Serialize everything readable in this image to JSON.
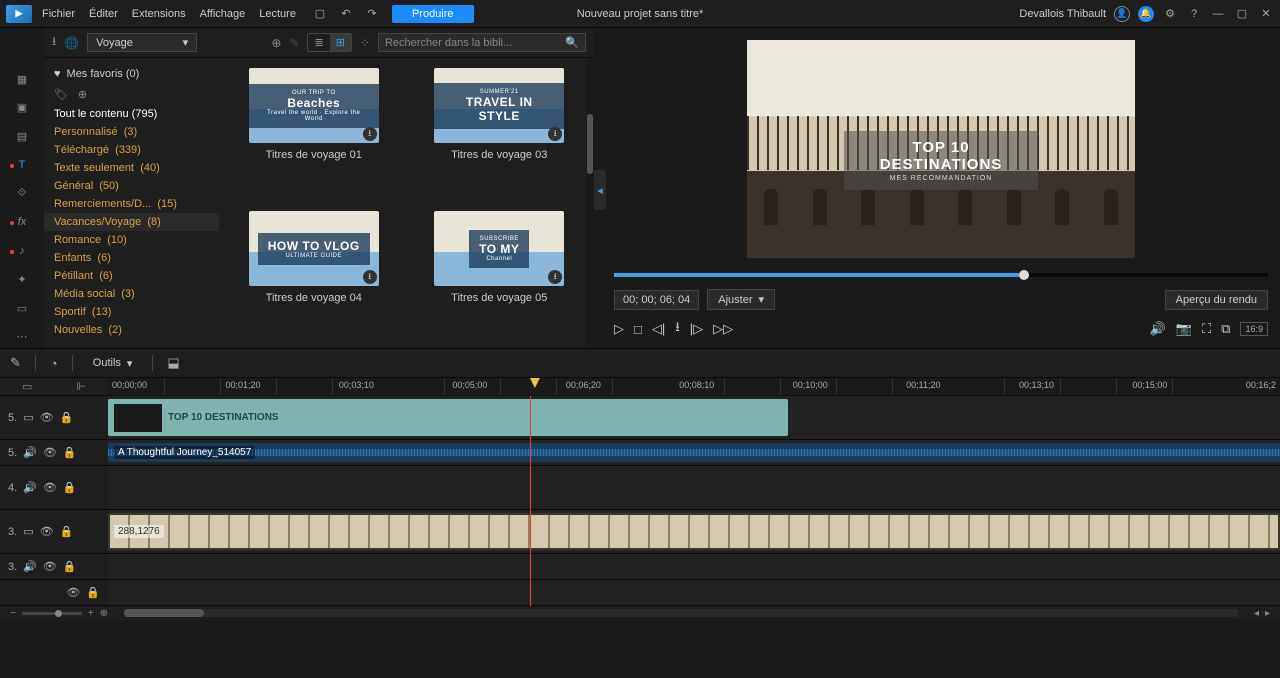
{
  "menu": {
    "file": "Fichier",
    "edit": "Éditer",
    "extensions": "Extensions",
    "display": "Affichage",
    "playback": "Lecture"
  },
  "topbar": {
    "produce": "Produire",
    "project_title": "Nouveau projet sans titre*",
    "username": "Devallois Thibault"
  },
  "room": {
    "category_selected": "Voyage",
    "search_placeholder": "Rechercher dans la bibli...",
    "favorites_label": "Mes favoris (0)",
    "all_content_label": "Tout le contenu (795)",
    "categories": [
      {
        "label": "Personnalisé",
        "count": "(3)"
      },
      {
        "label": "Téléchargé",
        "count": "(339)"
      },
      {
        "label": "Texte seulement",
        "count": "(40)"
      },
      {
        "label": "Général",
        "count": "(50)"
      },
      {
        "label": "Remerciements/D...",
        "count": "(15)"
      },
      {
        "label": "Vacances/Voyage",
        "count": "(8)"
      },
      {
        "label": "Romance",
        "count": "(10)"
      },
      {
        "label": "Enfants",
        "count": "(6)"
      },
      {
        "label": "Pétillant",
        "count": "(6)"
      },
      {
        "label": "Média social",
        "count": "(3)"
      },
      {
        "label": "Sportif",
        "count": "(13)"
      },
      {
        "label": "Nouvelles",
        "count": "(2)"
      }
    ],
    "templates": [
      {
        "name": "Titres de voyage 01",
        "ov_line1": "OUR TRIP TO",
        "ov_line2": "Beaches",
        "ov_line3": "Travel the world · Explore the World"
      },
      {
        "name": "Titres de voyage 03",
        "ov_line1": "SUMMER'21",
        "ov_line2": "TRAVEL IN STYLE",
        "ov_line3": ""
      },
      {
        "name": "Titres de voyage 04",
        "ov_line1": "",
        "ov_line2": "HOW TO VLOG",
        "ov_line3": "ULTIMATE GUIDE"
      },
      {
        "name": "Titres de voyage 05",
        "ov_line1": "SUBSCRIBE",
        "ov_line2": "TO MY",
        "ov_line3": "Channel"
      }
    ]
  },
  "preview": {
    "title_main": "TOP 10 DESTINATIONS",
    "title_sub": "MES RECOMMANDATION",
    "timecode": "00; 00; 06; 04",
    "fit_label": "Ajuster",
    "render_label": "Aperçu du rendu",
    "aspect": "16:9"
  },
  "timeline": {
    "tools_label": "Outils",
    "ruler_ticks": [
      "00;00;00",
      "00;01;20",
      "00;03;10",
      "00;05;00",
      "00;06;20",
      "00;08;10",
      "00;10;00",
      "00;11;20",
      "00;13;10",
      "00;15;00",
      "00;16;2"
    ],
    "tracks": {
      "t1": {
        "num": "5.",
        "title_clip_label": "TOP 10 DESTINATIONS"
      },
      "t2": {
        "num": "5.",
        "audio_clip_label": "A Thoughtful Journey_514057"
      },
      "t3": {
        "num": "4."
      },
      "t4": {
        "num": "3.",
        "video_clip_label": "288,1276"
      },
      "t5": {
        "num": "3."
      }
    }
  }
}
